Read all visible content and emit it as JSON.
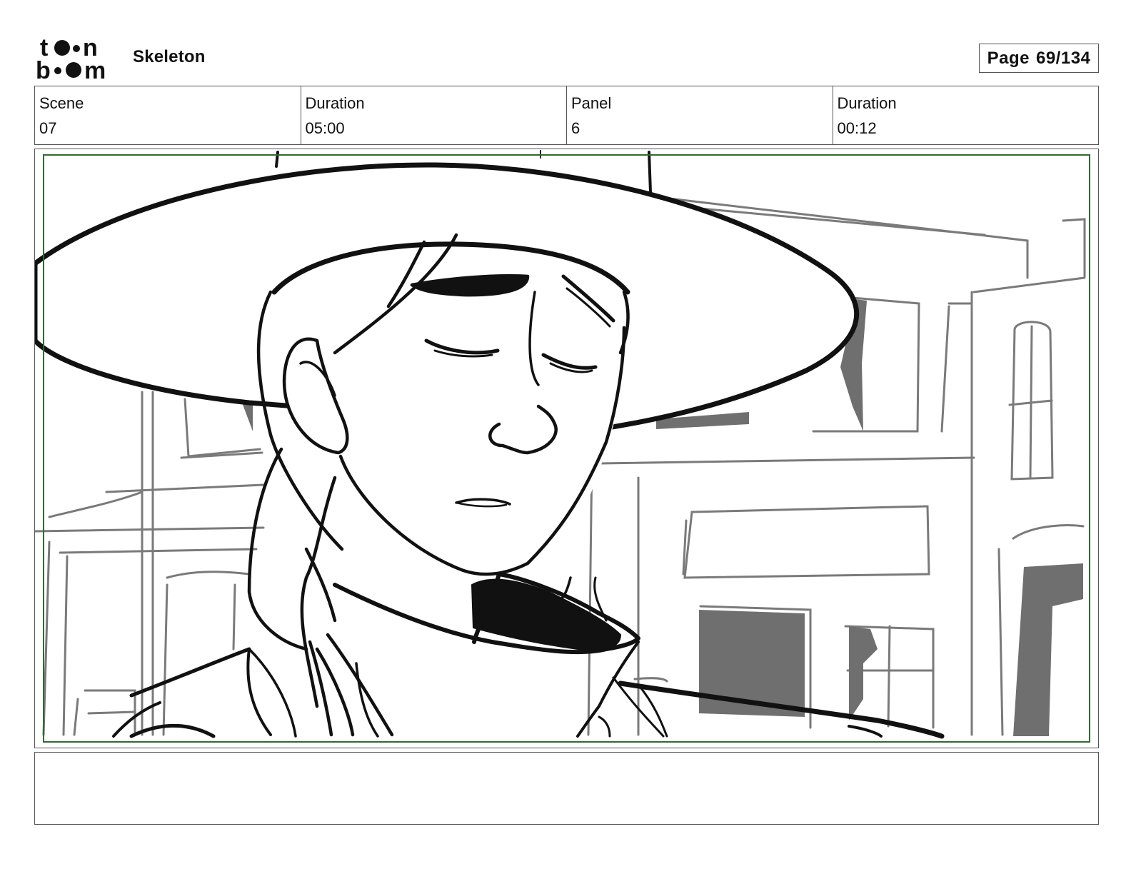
{
  "header": {
    "logo_alt": "toon boom",
    "project_title": "Skeleton",
    "page_label": "Page",
    "page_number": "69/134"
  },
  "info": {
    "scene_label": "Scene",
    "scene_value": "07",
    "scene_duration_label": "Duration",
    "scene_duration_value": "05:00",
    "panel_label": "Panel",
    "panel_value": "6",
    "panel_duration_label": "Duration",
    "panel_duration_value": "00:12"
  },
  "panel": {
    "description": "",
    "safe_frame_color": "#2f6b2f"
  },
  "notes": {
    "text": ""
  }
}
